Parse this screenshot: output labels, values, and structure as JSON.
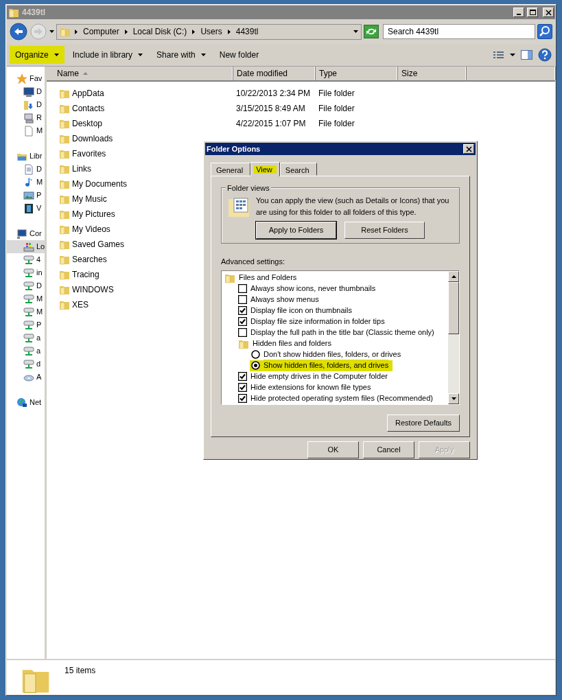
{
  "window": {
    "title": "4439tl"
  },
  "address": {
    "segments": [
      "Computer",
      "Local Disk (C:)",
      "Users",
      "4439tl"
    ]
  },
  "search": {
    "placeholder": "Search 4439tl"
  },
  "toolbar": [
    {
      "label": "Organize",
      "dropdown": true,
      "highlighted": true
    },
    {
      "label": "Include in library",
      "dropdown": true,
      "highlighted": false
    },
    {
      "label": "Share with",
      "dropdown": true,
      "highlighted": false
    },
    {
      "label": "New folder",
      "dropdown": false,
      "highlighted": false
    }
  ],
  "nav": [
    {
      "label": "Fav",
      "selected": false,
      "children": [
        {
          "label": "D",
          "selected": false
        },
        {
          "label": "D",
          "selected": false
        },
        {
          "label": "R",
          "selected": false
        },
        {
          "label": "M",
          "selected": false
        }
      ]
    },
    {
      "label": "Libr",
      "selected": false,
      "children": [
        {
          "label": "D",
          "selected": false
        },
        {
          "label": "M",
          "selected": false
        },
        {
          "label": "P",
          "selected": false
        },
        {
          "label": "V",
          "selected": false
        }
      ]
    },
    {
      "label": "Cor",
      "selected": false,
      "children": [
        {
          "label": "Lo",
          "selected": true
        },
        {
          "label": "4",
          "selected": false
        },
        {
          "label": "in",
          "selected": false
        },
        {
          "label": "D",
          "selected": false
        },
        {
          "label": "M",
          "selected": false
        },
        {
          "label": "M",
          "selected": false
        },
        {
          "label": "P",
          "selected": false
        },
        {
          "label": "a",
          "selected": false
        },
        {
          "label": "a",
          "selected": false
        },
        {
          "label": "d",
          "selected": false
        },
        {
          "label": "A",
          "selected": false
        }
      ]
    },
    {
      "label": "Net",
      "selected": false
    }
  ],
  "columns": [
    {
      "label": "Name",
      "sorted": true
    },
    {
      "label": "Date modified",
      "sorted": false
    },
    {
      "label": "Type",
      "sorted": false
    },
    {
      "label": "Size",
      "sorted": false
    }
  ],
  "files": [
    {
      "name": "AppData",
      "date": "10/22/2013 2:34 PM",
      "type": "File folder"
    },
    {
      "name": "Contacts",
      "date": "3/15/2015 8:49 AM",
      "type": "File folder"
    },
    {
      "name": "Desktop",
      "date": "4/22/2015 1:07 PM",
      "type": "File folder"
    },
    {
      "name": "Downloads"
    },
    {
      "name": "Favorites"
    },
    {
      "name": "Links"
    },
    {
      "name": "My Documents"
    },
    {
      "name": "My Music"
    },
    {
      "name": "My Pictures"
    },
    {
      "name": "My Videos"
    },
    {
      "name": "Saved Games"
    },
    {
      "name": "Searches"
    },
    {
      "name": "Tracing"
    },
    {
      "name": "WINDOWS"
    },
    {
      "name": "XES"
    }
  ],
  "status": {
    "count": "15 items"
  },
  "dialog": {
    "title": "Folder Options",
    "tabs": [
      {
        "label": "General",
        "selected": false,
        "highlighted": false
      },
      {
        "label": "View",
        "selected": true,
        "highlighted": true
      },
      {
        "label": "Search",
        "selected": false,
        "highlighted": false
      }
    ],
    "folder_views": {
      "heading": "Folder views",
      "text": "You can apply the view (such as Details or Icons) that you are using for this folder to all folders of this type.",
      "buttons": [
        {
          "label": "Apply to Folders",
          "default": true
        },
        {
          "label": "Reset Folders",
          "default": false
        }
      ]
    },
    "advanced_label": "Advanced settings:",
    "settings": [
      {
        "kind": "group",
        "label": "Files and Folders",
        "children": [
          {
            "kind": "checkbox",
            "label": "Always show icons, never thumbnails",
            "checked": false,
            "highlighted": false
          },
          {
            "kind": "checkbox",
            "label": "Always show menus",
            "checked": false,
            "highlighted": false
          },
          {
            "kind": "checkbox",
            "label": "Display file icon on thumbnails",
            "checked": true,
            "highlighted": false
          },
          {
            "kind": "checkbox",
            "label": "Display file size information in folder tips",
            "checked": true,
            "highlighted": false
          },
          {
            "kind": "checkbox",
            "label": "Display the full path in the title bar (Classic theme only)",
            "checked": false,
            "highlighted": false
          },
          {
            "kind": "group",
            "label": "Hidden files and folders",
            "children": [
              {
                "kind": "radio",
                "label": "Don't show hidden files, folders, or drives",
                "selected": false,
                "highlighted": false
              },
              {
                "kind": "radio",
                "label": "Show hidden files, folders, and drives",
                "selected": true,
                "highlighted": true
              }
            ]
          },
          {
            "kind": "checkbox",
            "label": "Hide empty drives in the Computer folder",
            "checked": true,
            "highlighted": false
          },
          {
            "kind": "checkbox",
            "label": "Hide extensions for known file types",
            "checked": true,
            "highlighted": false
          },
          {
            "kind": "checkbox",
            "label": "Hide protected operating system files (Recommended)",
            "checked": true,
            "highlighted": false
          }
        ]
      }
    ],
    "restore": "Restore Defaults",
    "buttons": [
      {
        "label": "OK",
        "disabled": false
      },
      {
        "label": "Cancel",
        "disabled": false
      },
      {
        "label": "Apply",
        "disabled": true
      }
    ]
  }
}
